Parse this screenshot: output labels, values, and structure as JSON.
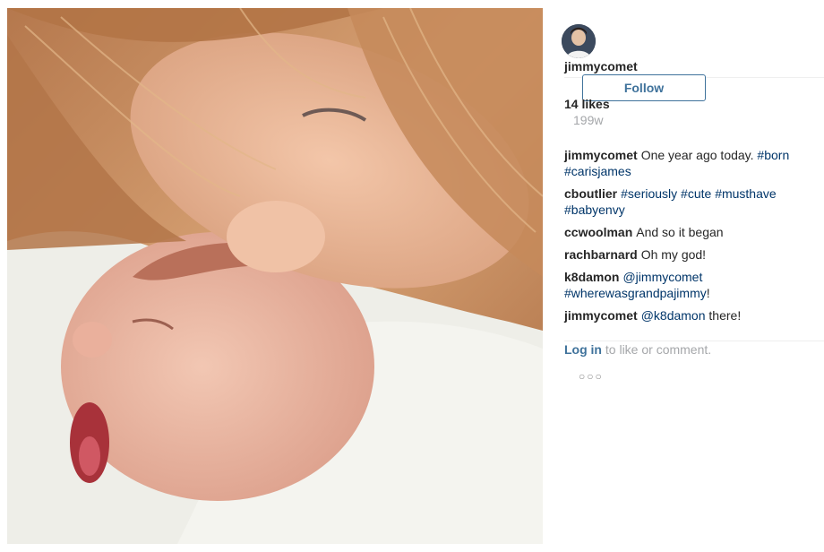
{
  "post": {
    "username": "jimmycomet",
    "follow_label": "Follow",
    "likes": "14 likes",
    "age": "199w"
  },
  "comments": [
    {
      "author": "jimmycomet",
      "parts": [
        {
          "text": "One year ago today. ",
          "tag": false
        },
        {
          "text": "#born",
          "tag": true
        },
        {
          "text": " ",
          "tag": false
        },
        {
          "text": "#carisjames",
          "tag": true
        }
      ]
    },
    {
      "author": "cboutlier",
      "parts": [
        {
          "text": "#seriously",
          "tag": true
        },
        {
          "text": " ",
          "tag": false
        },
        {
          "text": "#cute",
          "tag": true
        },
        {
          "text": " ",
          "tag": false
        },
        {
          "text": "#musthave",
          "tag": true
        },
        {
          "text": " ",
          "tag": false
        },
        {
          "text": "#babyenvy",
          "tag": true
        }
      ]
    },
    {
      "author": "ccwoolman",
      "parts": [
        {
          "text": "And so it began",
          "tag": false
        }
      ]
    },
    {
      "author": "rachbarnard",
      "parts": [
        {
          "text": "Oh my god!",
          "tag": false
        }
      ]
    },
    {
      "author": "k8damon",
      "parts": [
        {
          "text": "@jimmycomet",
          "tag": true
        },
        {
          "text": " ",
          "tag": false
        },
        {
          "text": "#wherewasgrandpajimmy",
          "tag": true
        },
        {
          "text": "!",
          "tag": false
        }
      ]
    },
    {
      "author": "jimmycomet",
      "parts": [
        {
          "text": "@k8damon",
          "tag": true
        },
        {
          "text": " there!",
          "tag": false
        }
      ]
    }
  ],
  "login": {
    "link": "Log in",
    "rest": " to like or comment."
  },
  "more_icon": "more-options-icon",
  "colors": {
    "link": "#3f729b",
    "tag": "#003569",
    "muted": "#a5a7aa"
  }
}
